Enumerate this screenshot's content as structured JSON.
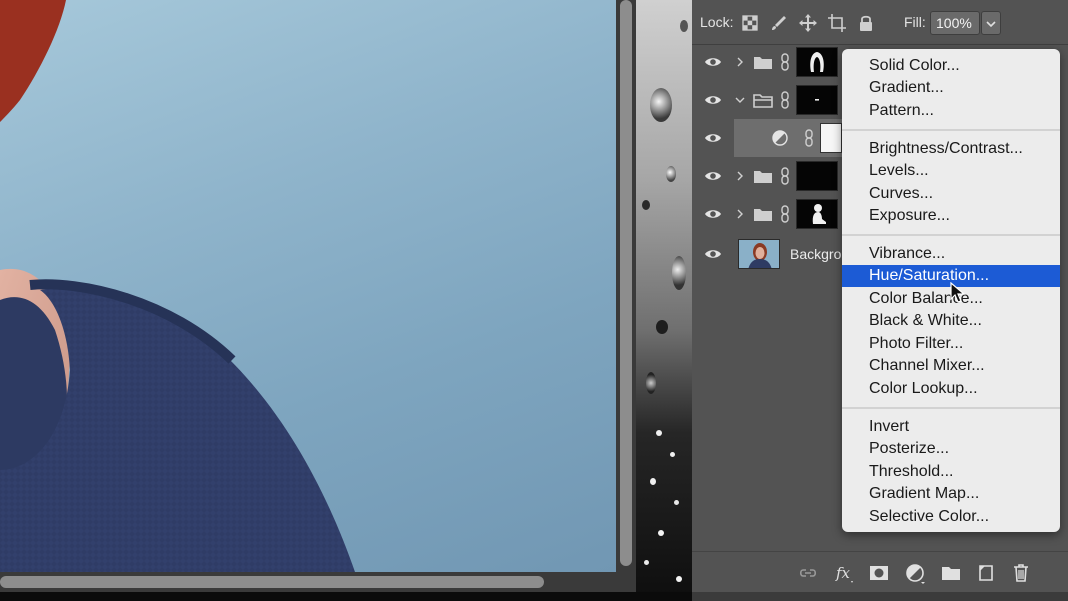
{
  "lock_bar": {
    "lock_label": "Lock:",
    "fill_label": "Fill:",
    "fill_value": "100%"
  },
  "layers": [
    {
      "type": "group",
      "expanded": false,
      "mask": "black-with-head-shape"
    },
    {
      "type": "group",
      "expanded": true,
      "mask": "black-with-dash"
    },
    {
      "type": "adjustment",
      "selected": true
    },
    {
      "type": "group",
      "expanded": false,
      "mask": "black"
    },
    {
      "type": "group",
      "expanded": false,
      "mask": "black-with-figure"
    },
    {
      "type": "background",
      "name": "Backgro"
    }
  ],
  "menu": {
    "items": [
      "Solid Color...",
      "Gradient...",
      "Pattern...",
      "Brightness/Contrast...",
      "Levels...",
      "Curves...",
      "Exposure...",
      "Vibrance...",
      "Hue/Saturation...",
      "Color Balance...",
      "Black & White...",
      "Photo Filter...",
      "Channel Mixer...",
      "Color Lookup...",
      "Invert",
      "Posterize...",
      "Threshold...",
      "Gradient Map...",
      "Selective Color..."
    ],
    "highlighted": "Hue/Saturation..."
  },
  "colors": {
    "panel_bg": "#535353",
    "menu_bg": "#ececec",
    "menu_highlight": "#1c5bd5",
    "canvas_sky": "#8fb4cb",
    "sweater": "#2e3b63"
  },
  "bottom_icons": [
    "link-layers-icon",
    "fx-icon",
    "add-mask-icon",
    "new-adjustment-layer-icon",
    "new-group-icon",
    "new-layer-icon",
    "delete-layer-icon"
  ]
}
